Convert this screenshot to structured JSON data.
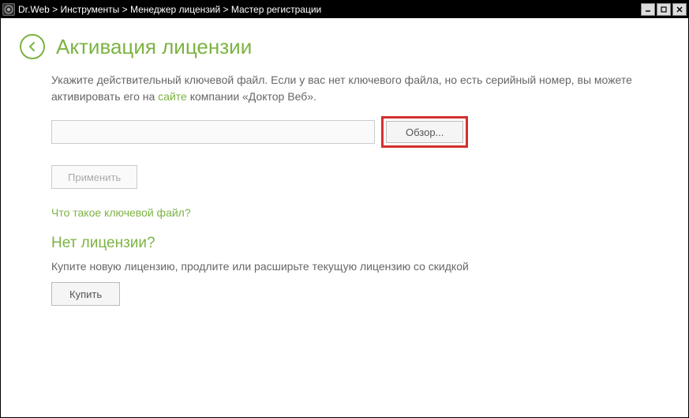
{
  "titlebar": {
    "breadcrumb": "Dr.Web > Инструменты > Менеджер лицензий > Мастер регистрации"
  },
  "header": {
    "title": "Активация лицензии"
  },
  "instruction": {
    "text_before": "Укажите действительный ключевой файл. Если у вас нет ключевого файла, но есть серийный номер, вы можете активировать его на ",
    "link": "сайте",
    "text_after": " компании «Доктор Веб»."
  },
  "file": {
    "input_value": "",
    "browse_label": "Обзор..."
  },
  "apply": {
    "label": "Применить"
  },
  "key_file_link": {
    "label": "Что такое ключевой файл?"
  },
  "no_license": {
    "heading": "Нет лицензии?",
    "text": "Купите новую лицензию, продлите или расширьте текущую лицензию со скидкой",
    "buy_label": "Купить"
  }
}
